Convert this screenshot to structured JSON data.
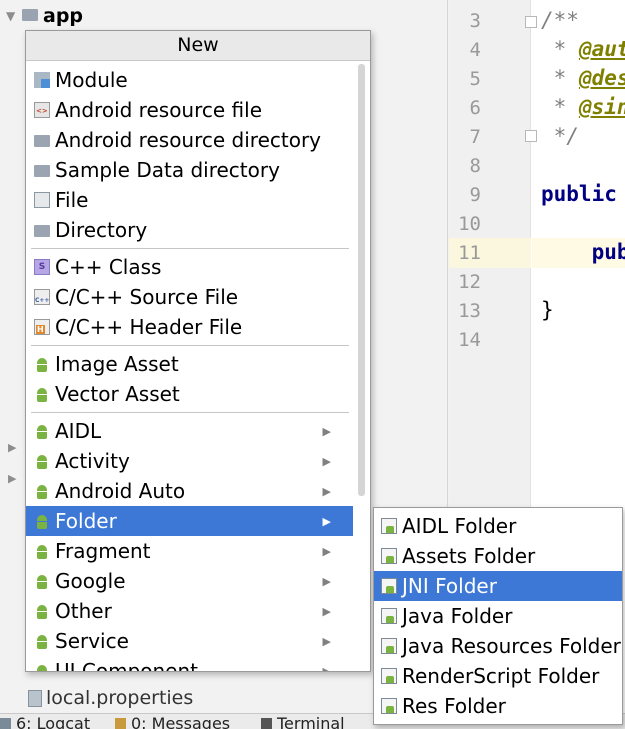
{
  "project": {
    "root_label": "app",
    "local_file": "local.properties"
  },
  "editor": {
    "line_numbers": [
      "3",
      "4",
      "5",
      "6",
      "7",
      "8",
      "9",
      "10",
      "11",
      "12",
      "13",
      "14"
    ],
    "lines": {
      "l3": "/**",
      "l4_prefix": " * ",
      "l4_tag": "@aut",
      "l5_prefix": " * ",
      "l5_tag": "@des",
      "l6_prefix": " * ",
      "l6_tag": "@sin",
      "l7": " */",
      "l9": "public",
      "l11": "    publ",
      "l13": "}"
    }
  },
  "new_menu": {
    "title": "New",
    "items": [
      {
        "label": "Module",
        "icon": "module-icon",
        "submenu": false
      },
      {
        "label": "Android resource file",
        "icon": "resource-file-icon",
        "submenu": false
      },
      {
        "label": "Android resource directory",
        "icon": "folder-icon",
        "submenu": false
      },
      {
        "label": "Sample Data directory",
        "icon": "folder-icon",
        "submenu": false
      },
      {
        "label": "File",
        "icon": "file-icon",
        "submenu": false
      },
      {
        "label": "Directory",
        "icon": "folder-icon",
        "submenu": false
      },
      {
        "label": "C++ Class",
        "icon": "cpp-class-icon",
        "submenu": false
      },
      {
        "label": "C/C++ Source File",
        "icon": "cpp-source-icon",
        "submenu": false
      },
      {
        "label": "C/C++ Header File",
        "icon": "cpp-header-icon",
        "submenu": false
      },
      {
        "label": "Image Asset",
        "icon": "android-icon",
        "submenu": false
      },
      {
        "label": "Vector Asset",
        "icon": "android-icon",
        "submenu": false
      },
      {
        "label": "AIDL",
        "icon": "android-icon",
        "submenu": true
      },
      {
        "label": "Activity",
        "icon": "android-icon",
        "submenu": true
      },
      {
        "label": "Android Auto",
        "icon": "android-icon",
        "submenu": true
      },
      {
        "label": "Folder",
        "icon": "android-icon",
        "submenu": true,
        "selected": true
      },
      {
        "label": "Fragment",
        "icon": "android-icon",
        "submenu": true
      },
      {
        "label": "Google",
        "icon": "android-icon",
        "submenu": true
      },
      {
        "label": "Other",
        "icon": "android-icon",
        "submenu": true
      },
      {
        "label": "Service",
        "icon": "android-icon",
        "submenu": true
      },
      {
        "label": "UI Component",
        "icon": "android-icon",
        "submenu": true
      }
    ]
  },
  "folder_menu": {
    "items": [
      {
        "label": "AIDL Folder"
      },
      {
        "label": "Assets Folder"
      },
      {
        "label": "JNI Folder",
        "selected": true
      },
      {
        "label": "Java Folder"
      },
      {
        "label": "Java Resources Folder"
      },
      {
        "label": "RenderScript Folder"
      },
      {
        "label": "Res Folder"
      }
    ]
  },
  "statusbar": {
    "logcat": "6: Logcat",
    "messages": "0: Messages",
    "terminal": "Terminal"
  },
  "colors": {
    "selection": "#3d78d6",
    "android_green": "#7bb342",
    "keyword": "#000080",
    "doc_tag": "#808000"
  }
}
